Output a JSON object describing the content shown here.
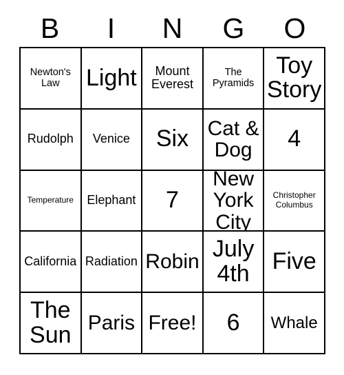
{
  "card": {
    "header_letters": [
      "B",
      "I",
      "N",
      "G",
      "O"
    ],
    "rows": [
      [
        {
          "text": "Newton's\nLaw",
          "size": "sm"
        },
        {
          "text": "Light",
          "size": "xxl"
        },
        {
          "text": "Mount\nEverest",
          "size": "md"
        },
        {
          "text": "The\nPyramids",
          "size": "sm"
        },
        {
          "text": "Toy\nStory",
          "size": "xxl"
        }
      ],
      [
        {
          "text": "Rudolph",
          "size": "md"
        },
        {
          "text": "Venice",
          "size": "md"
        },
        {
          "text": "Six",
          "size": "xxl"
        },
        {
          "text": "Cat &\nDog",
          "size": "xl"
        },
        {
          "text": "4",
          "size": "xxl"
        }
      ],
      [
        {
          "text": "Temperature",
          "size": "xs"
        },
        {
          "text": "Elephant",
          "size": "md"
        },
        {
          "text": "7",
          "size": "xxl"
        },
        {
          "text": "New\nYork\nCity",
          "size": "xl"
        },
        {
          "text": "Christopher\nColumbus",
          "size": "xs"
        }
      ],
      [
        {
          "text": "California",
          "size": "md"
        },
        {
          "text": "Radiation",
          "size": "md"
        },
        {
          "text": "Robin",
          "size": "xl"
        },
        {
          "text": "July\n4th",
          "size": "xxl"
        },
        {
          "text": "Five",
          "size": "xxl"
        }
      ],
      [
        {
          "text": "The\nSun",
          "size": "xxl"
        },
        {
          "text": "Paris",
          "size": "xl"
        },
        {
          "text": "Free!",
          "size": "xl"
        },
        {
          "text": "6",
          "size": "xxl"
        },
        {
          "text": "Whale",
          "size": "lg"
        }
      ]
    ]
  },
  "colors": {
    "border": "#000000",
    "cell_background": "#ffffff",
    "text": "#000000"
  }
}
